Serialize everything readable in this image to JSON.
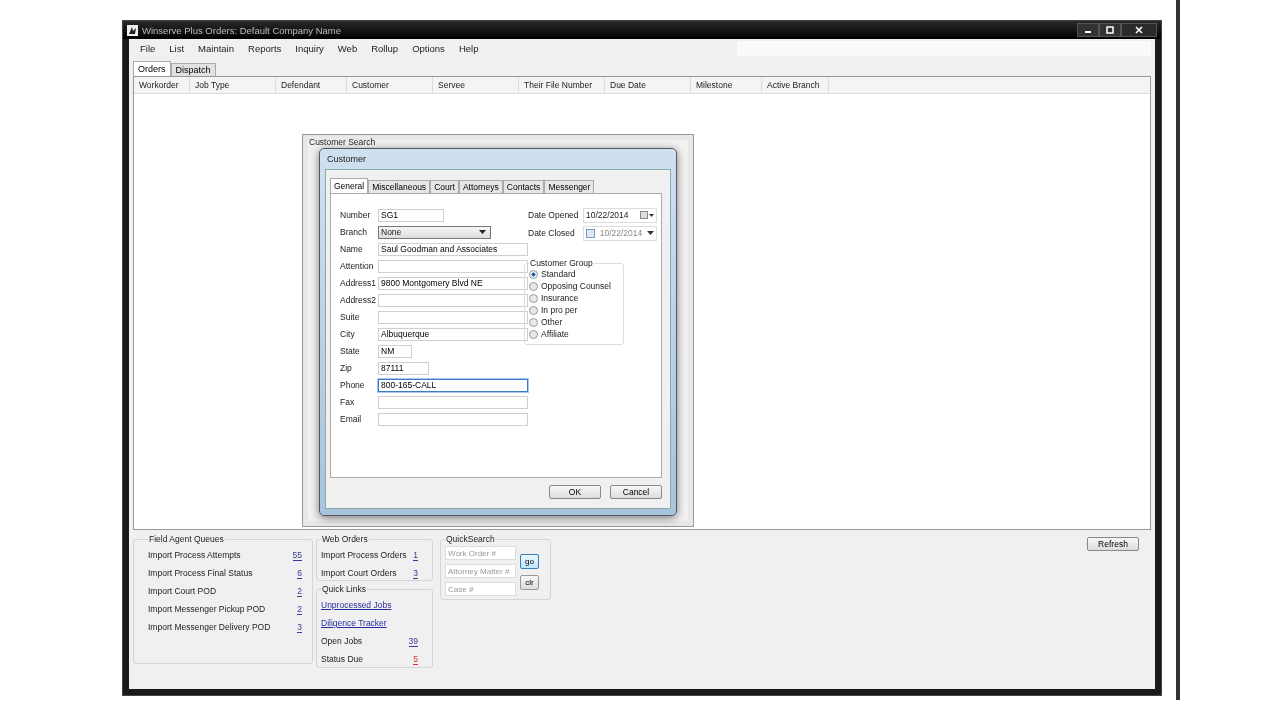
{
  "window": {
    "title": "Winserve Plus Orders: Default Company Name"
  },
  "menu": [
    "File",
    "List",
    "Maintain",
    "Reports",
    "Inquiry",
    "Web",
    "Rollup",
    "Options",
    "Help"
  ],
  "tabs": [
    {
      "label": "Orders",
      "selected": true
    },
    {
      "label": "Dispatch",
      "selected": false
    }
  ],
  "grid": {
    "columns": [
      "Workorder",
      "Job Type",
      "Defendant",
      "Customer",
      "Servee",
      "Their File Number",
      "Due Date",
      "Milestone",
      "Active Branch"
    ]
  },
  "search_window": {
    "title": "Customer Search"
  },
  "customer_dialog": {
    "title": "Customer",
    "tabs": [
      {
        "label": "General",
        "selected": true
      },
      {
        "label": "Miscellaneous",
        "selected": false
      },
      {
        "label": "Court",
        "selected": false
      },
      {
        "label": "Attorneys",
        "selected": false
      },
      {
        "label": "Contacts",
        "selected": false
      },
      {
        "label": "Messenger",
        "selected": false
      }
    ],
    "fields": [
      {
        "label": "Number",
        "value": "SG1",
        "kind": "text"
      },
      {
        "label": "Branch",
        "value": "None",
        "kind": "select"
      },
      {
        "label": "Name",
        "value": "Saul Goodman and Associates",
        "kind": "text"
      },
      {
        "label": "Attention",
        "kind": "text"
      },
      {
        "label": "Address1",
        "value": "9800 Montgomery Blvd NE",
        "kind": "text"
      },
      {
        "label": "Address2",
        "kind": "text"
      },
      {
        "label": "Suite",
        "kind": "text"
      },
      {
        "label": "City",
        "value": "Albuquerque",
        "kind": "text"
      },
      {
        "label": "State",
        "value": "NM",
        "kind": "text"
      },
      {
        "label": "Zip",
        "value": "87111",
        "kind": "text"
      },
      {
        "label": "Phone",
        "value": "800-165-CALL",
        "kind": "text",
        "focused": true
      },
      {
        "label": "Fax",
        "kind": "text"
      },
      {
        "label": "Email",
        "kind": "text"
      }
    ],
    "dates": [
      {
        "label": "Date Opened",
        "value": "10/22/2014",
        "kind": "date"
      },
      {
        "label": "Date Closed",
        "value": "10/22/2014",
        "kind": "checkable_date",
        "checked": false
      }
    ],
    "customer_group": {
      "title": "Customer Group",
      "options": [
        {
          "label": "Standard",
          "selected": true
        },
        {
          "label": "Opposing Counsel",
          "selected": false
        },
        {
          "label": "Insurance",
          "selected": false
        },
        {
          "label": "In pro per",
          "selected": false
        },
        {
          "label": "Other",
          "selected": false
        },
        {
          "label": "Affiliate",
          "selected": false
        }
      ]
    },
    "buttons": [
      "OK",
      "Cancel"
    ]
  },
  "field_agent_queues": {
    "title": "Field Agent Queues",
    "items": [
      {
        "label": "Import Process Attempts",
        "count": "55"
      },
      {
        "label": "Import Process Final Status",
        "count": "6"
      },
      {
        "label": "Import Court POD",
        "count": "2"
      },
      {
        "label": "Import Messenger Pickup POD",
        "count": "2"
      },
      {
        "label": "Import Messenger Delivery POD",
        "count": "3"
      }
    ]
  },
  "web_orders": {
    "title": "Web Orders",
    "items": [
      {
        "label": "Import Process Orders",
        "count": "1"
      },
      {
        "label": "Import Court Orders",
        "count": "3"
      }
    ]
  },
  "quick_links": {
    "title": "Quick Links",
    "links": [
      "Unprocessed Jobs",
      "Diligence Tracker"
    ],
    "items": [
      {
        "label": "Open Jobs",
        "count": "39",
        "color": "#3a3a9a"
      },
      {
        "label": "Status Due",
        "count": "5",
        "color": "#d03030"
      }
    ]
  },
  "quick_search": {
    "title": "QuickSearch",
    "fields": [
      {
        "placeholder": "Work Order #"
      },
      {
        "placeholder": "Attorney Matter #"
      },
      {
        "placeholder": "Case #"
      }
    ],
    "buttons": [
      {
        "label": "go",
        "default": true
      },
      {
        "label": "clr",
        "default": false
      }
    ]
  },
  "refresh_button": "Refresh"
}
